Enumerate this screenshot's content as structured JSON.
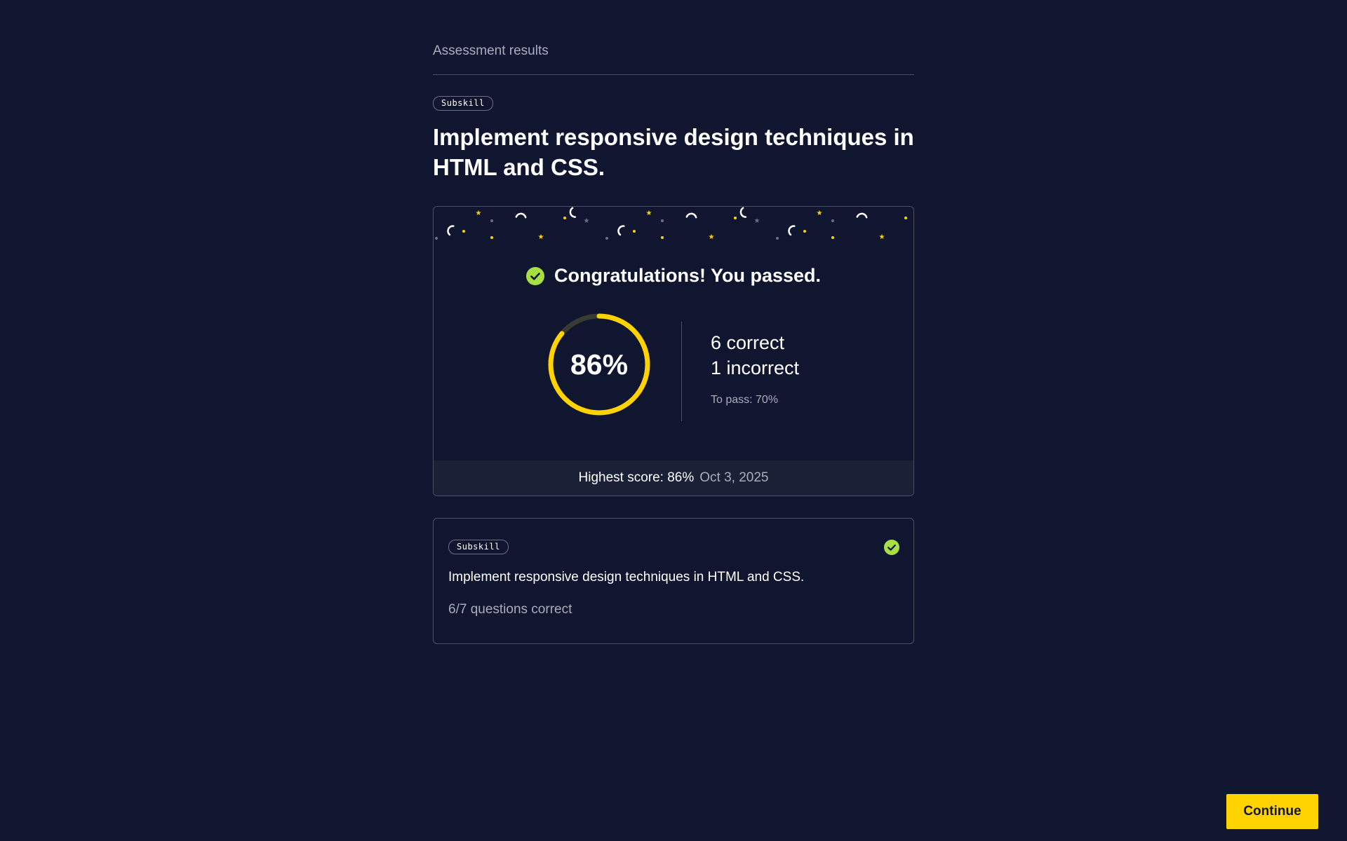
{
  "page": {
    "header_title": "Assessment results"
  },
  "hero": {
    "tag": "Subskill",
    "title": "Implement responsive design techniques in HTML and CSS."
  },
  "result": {
    "headline": "Congratulations! You passed.",
    "headline_icon": "check-circle-icon",
    "score_percent": 86,
    "score_label": "86%",
    "correct_text": "6 correct",
    "incorrect_text": "1 incorrect",
    "pass_threshold_text": "To pass: 70%",
    "highest_score_text": "Highest score: 86%",
    "highest_score_date": "Oct 3, 2025"
  },
  "skill_card": {
    "tag": "Subskill",
    "title": "Implement responsive design techniques in HTML and CSS.",
    "progress_text": "6/7 questions correct",
    "status_icon": "check-circle-icon"
  },
  "actions": {
    "continue_label": "Continue"
  },
  "colors": {
    "background": "#10162f",
    "accent_yellow": "#ffd300",
    "success_green": "#a8e043",
    "border": "#4b5064",
    "muted_text": "#a9adbd",
    "ring_track": "#3a3a33"
  }
}
